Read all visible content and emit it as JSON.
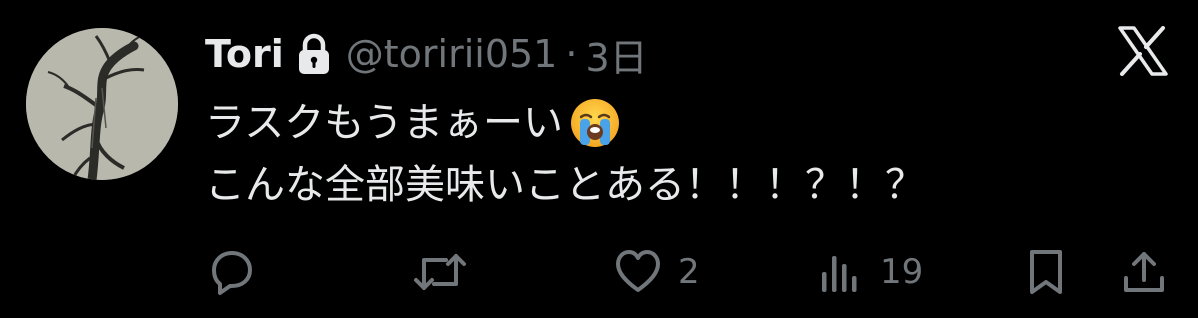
{
  "tweet": {
    "display_name": "Tori",
    "protected_icon": "lock-icon",
    "handle": "@toririi051",
    "separator": "·",
    "time": "3日",
    "platform_icon": "x-logo-icon",
    "text_lines": [
      "ラスクもうまぁーい",
      "こんな全部美味いことある！！！？！？"
    ],
    "emoji": "loudly-crying-face-emoji",
    "actions": {
      "reply": {
        "icon": "reply-icon"
      },
      "retweet": {
        "icon": "retweet-icon"
      },
      "like": {
        "icon": "heart-icon",
        "count": "2"
      },
      "views": {
        "icon": "views-icon",
        "count": "19"
      },
      "bookmark": {
        "icon": "bookmark-icon"
      },
      "share": {
        "icon": "share-icon"
      }
    }
  },
  "colors": {
    "background": "#000000",
    "primary_text": "#e7e9ea",
    "secondary_text": "#71767b"
  }
}
